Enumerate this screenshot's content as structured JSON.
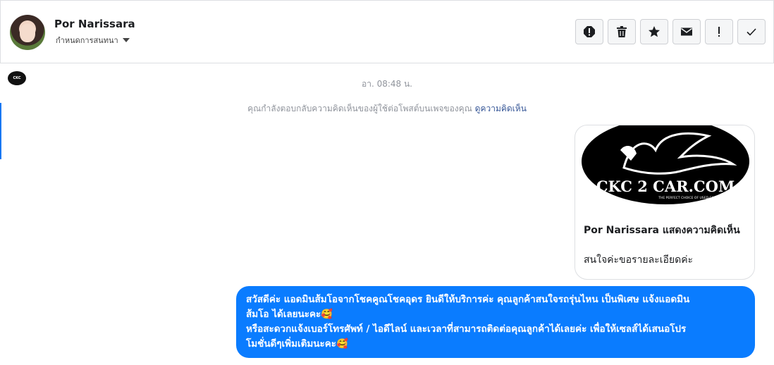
{
  "header": {
    "contact_name": "Por Narissara",
    "assign_label": "กำหนดการสนทนา",
    "actions": [
      "spam-icon",
      "trash-icon",
      "star-icon",
      "mail-icon",
      "important-icon",
      "check-icon"
    ]
  },
  "conversation": {
    "timestamp": "อา. 08:48 น.",
    "notice_text": "คุณกำลังตอบกลับความคิดเห็นของผู้ใช้ต่อโพสต์บนเพจของคุณ ",
    "notice_link": "ดูความคิดเห็น",
    "card": {
      "logo_text": "CKC 2 CAR.COM",
      "logo_tagline": "THE PERFECT CHOICE OF USED CAR",
      "title": "Por Narissara แสดงความคิดเห็น",
      "comment": "สนใจค่ะขอรายละเอียดค่ะ"
    },
    "reply_line1": "สวัสดีค่ะ แอดมินส้มโอจากโชคคูณโชคอุดร ยินดีให้บริการค่ะ   คุณลูกค้าสนใจรถรุ่นไหน เป็นพิเศษ แจ้งแอดมิน",
    "reply_line2": "ส้มโอ ได้เลยนะคะ🥰",
    "reply_line3": "หรือสะดวกแจ้งเบอร์โทรศัพท์ / ไอดีไลน์ และเวลาที่สามารถติดต่อคุณลูกค้าได้เลยค่ะ เพื่อให้เซลส์ได้เสนอโปร",
    "reply_line4": "โมชั่นดีๆเพิ่มเติมนะคะ🥰"
  },
  "colors": {
    "accent": "#0a7cff",
    "link": "#385898"
  }
}
